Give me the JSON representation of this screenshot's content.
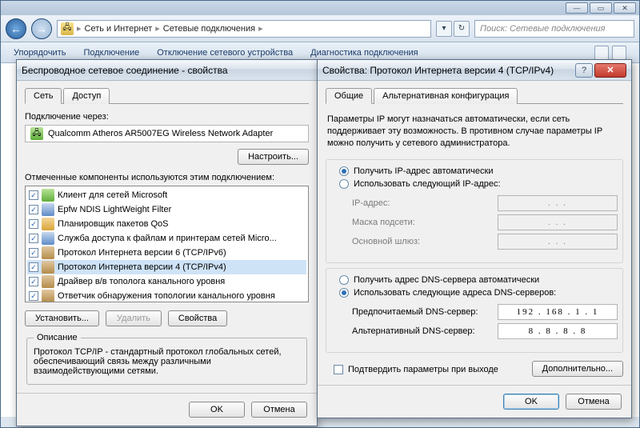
{
  "explorer": {
    "crumb1": "Сеть и Интернет",
    "crumb2": "Сетевые подключения",
    "search_placeholder": "Поиск: Сетевые подключения",
    "toolbar": {
      "item1": "Упорядочить",
      "item2": "Подключение",
      "item3": "Отключение сетевого устройства",
      "item4": "Диагностика подключения"
    }
  },
  "props": {
    "title": "Беспроводное сетевое соединение - свойства",
    "tab_net": "Сеть",
    "tab_access": "Доступ",
    "connect_via": "Подключение через:",
    "adapter": "Qualcomm Atheros AR5007EG Wireless Network Adapter",
    "configure": "Настроить...",
    "components_label": "Отмеченные компоненты используются этим подключением:",
    "components": [
      "Клиент для сетей Microsoft",
      "Epfw NDIS LightWeight Filter",
      "Планировщик пакетов QoS",
      "Служба доступа к файлам и принтерам сетей Micro...",
      "Протокол Интернета версии 6 (TCP/IPv6)",
      "Протокол Интернета версии 4 (TCP/IPv4)",
      "Драйвер в/в тополога канального уровня",
      "Ответчик обнаружения топологии канального уровня"
    ],
    "install": "Установить...",
    "remove": "Удалить",
    "properties_btn": "Свойства",
    "desc_legend": "Описание",
    "desc_text": "Протокол TCP/IP - стандартный протокол глобальных сетей, обеспечивающий связь между различными взаимодействующими сетями.",
    "ok": "OK",
    "cancel": "Отмена"
  },
  "ipv4": {
    "title": "Свойства: Протокол Интернета версии 4 (TCP/IPv4)",
    "tab_general": "Общие",
    "tab_alt": "Альтернативная конфигурация",
    "intro": "Параметры IP могут назначаться автоматически, если сеть поддерживает эту возможность. В противном случае параметры IP можно получить у сетевого администратора.",
    "ip_auto": "Получить IP-адрес автоматически",
    "ip_manual": "Использовать следующий IP-адрес:",
    "ip_addr_label": "IP-адрес:",
    "mask_label": "Маска подсети:",
    "gw_label": "Основной шлюз:",
    "dns_auto": "Получить адрес DNS-сервера автоматически",
    "dns_manual": "Использовать следующие адреса DNS-серверов:",
    "dns_pref_label": "Предпочитаемый DNS-сервер:",
    "dns_pref_value": "192 . 168 .  1  .  1",
    "dns_alt_label": "Альтернативный DNS-сервер:",
    "dns_alt_value": "8  .  8  .  8  .  8",
    "confirm_on_exit": "Подтвердить параметры при выходе",
    "advanced": "Дополнительно...",
    "ok": "OK",
    "cancel": "Отмена",
    "ip_dots": ".        .        ."
  }
}
